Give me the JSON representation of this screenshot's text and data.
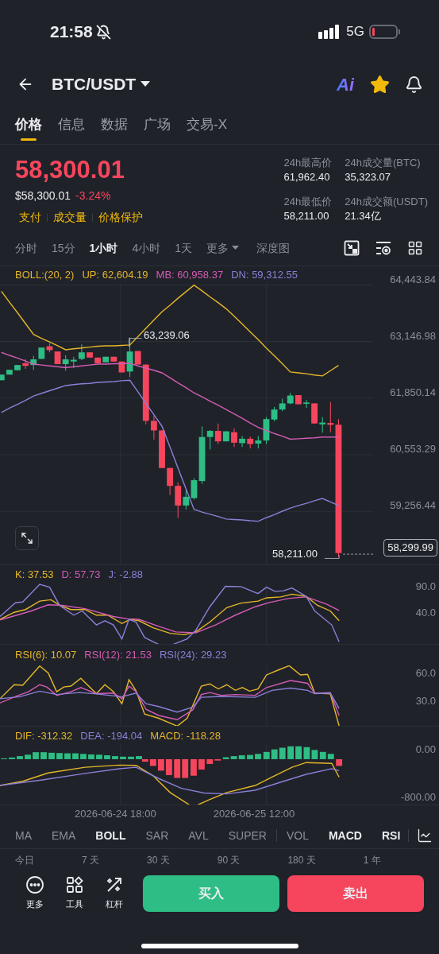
{
  "status_bar": {
    "time": "21:58",
    "network": "5G"
  },
  "header": {
    "pair": "BTC/USDT",
    "ai_label": "Ai",
    "favorite": true
  },
  "tabs": [
    {
      "label": "价格",
      "selected": true
    },
    {
      "label": "信息",
      "selected": false
    },
    {
      "label": "数据",
      "selected": false
    },
    {
      "label": "广场",
      "selected": false
    },
    {
      "label": "交易-X",
      "selected": false
    }
  ],
  "price": {
    "last": "58,300.01",
    "usd_value": "$58,300.01",
    "change": "-3.24%",
    "tags": [
      "支付",
      "成交量",
      "价格保护"
    ]
  },
  "stats": [
    {
      "label": "24h最高价",
      "value": "61,962.40"
    },
    {
      "label": "24h成交量(BTC)",
      "value": "35,323.07"
    },
    {
      "label": "24h最低价",
      "value": "58,211.00"
    },
    {
      "label": "24h成交额(USDT)",
      "value": "21.34亿"
    }
  ],
  "intervals": [
    {
      "label": "分时",
      "selected": false,
      "kind": "option"
    },
    {
      "label": "15分",
      "selected": false,
      "kind": "option"
    },
    {
      "label": "1小时",
      "selected": true,
      "kind": "option"
    },
    {
      "label": "4小时",
      "selected": false,
      "kind": "option"
    },
    {
      "label": "1天",
      "selected": false,
      "kind": "option"
    },
    {
      "label": "更多",
      "selected": false,
      "kind": "dropdown"
    },
    {
      "label": "深度图",
      "selected": false,
      "kind": "option"
    }
  ],
  "main_chart": {
    "legend": [
      {
        "text": "BOLL:(20, 2)",
        "color": "#e5b629"
      },
      {
        "text": "UP: 62,604.19",
        "color": "#e5b629"
      },
      {
        "text": "MB: 60,958.37",
        "color": "#d45bb5"
      },
      {
        "text": "DN: 59,312.55",
        "color": "#8b7fd8"
      }
    ],
    "chart_data": {
      "type": "candlestick",
      "grid": true,
      "categories": [
        null,
        null,
        null,
        null,
        null,
        null,
        null,
        null,
        null,
        null,
        null,
        null,
        null,
        null,
        null,
        null,
        null,
        null,
        null,
        null,
        null,
        null,
        null,
        null,
        null,
        null,
        null,
        null,
        null,
        null,
        null,
        null,
        null,
        null,
        null,
        null,
        null,
        null,
        null,
        null,
        null,
        null,
        null
      ],
      "ylim": [
        58039,
        64489
      ],
      "ohlc": [
        [
          62260,
          62390,
          62260,
          62390
        ],
        [
          62390,
          62500,
          62390,
          62500
        ],
        [
          62490,
          62610,
          62490,
          62610
        ],
        [
          62650,
          62750,
          62520,
          62590
        ],
        [
          62610,
          62820,
          62500,
          62740
        ],
        [
          62750,
          63010,
          62750,
          63010
        ],
        [
          63040,
          63110,
          62900,
          62950
        ],
        [
          62920,
          62920,
          62630,
          62630
        ],
        [
          62630,
          62830,
          62480,
          62740
        ],
        [
          62690,
          62800,
          62540,
          62730
        ],
        [
          62750,
          63080,
          62720,
          62900
        ],
        [
          62900,
          62900,
          62780,
          62780
        ],
        [
          62780,
          62780,
          62650,
          62650
        ],
        [
          62670,
          62800,
          62670,
          62800
        ],
        [
          62800,
          62800,
          62690,
          62690
        ],
        [
          62690,
          62690,
          62440,
          62440
        ],
        [
          62460,
          63240,
          62330,
          62920
        ],
        [
          62930,
          62930,
          62620,
          62620
        ],
        [
          62620,
          62620,
          61250,
          61330
        ],
        [
          61330,
          61450,
          60900,
          61110
        ],
        [
          61110,
          61110,
          60250,
          60250
        ],
        [
          60250,
          60250,
          59630,
          59840
        ],
        [
          59840,
          59920,
          59110,
          59390
        ],
        [
          59390,
          59760,
          59300,
          59590
        ],
        [
          59560,
          60020,
          59530,
          59970
        ],
        [
          59950,
          61200,
          59890,
          60960
        ],
        [
          60960,
          61120,
          60670,
          61100
        ],
        [
          61100,
          61270,
          60800,
          60860
        ],
        [
          60860,
          61090,
          60860,
          61090
        ],
        [
          61070,
          61160,
          60730,
          60830
        ],
        [
          60820,
          60980,
          60730,
          60920
        ],
        [
          60920,
          60970,
          60700,
          60800
        ],
        [
          60810,
          60980,
          60700,
          60880
        ],
        [
          60880,
          61420,
          60800,
          61370
        ],
        [
          61360,
          61650,
          61320,
          61590
        ],
        [
          61590,
          61840,
          61550,
          61730
        ],
        [
          61730,
          61970,
          61710,
          61910
        ],
        [
          61920,
          61920,
          61710,
          61710
        ],
        [
          61720,
          61810,
          61630,
          61750
        ],
        [
          61730,
          61730,
          61270,
          61270
        ],
        [
          61250,
          61420,
          61060,
          61290
        ],
        [
          61280,
          61760,
          61070,
          61240
        ],
        [
          61240,
          61370,
          58210,
          58300
        ]
      ],
      "yticks": [
        {
          "value": 64443.84,
          "label": "64,443.84"
        },
        {
          "value": 63146.98,
          "label": "63,146.98"
        },
        {
          "value": 61850.14,
          "label": "61,850.14"
        },
        {
          "value": 60553.29,
          "label": "60,553.29"
        },
        {
          "value": 59256.44,
          "label": "59,256.44"
        }
      ],
      "series": [
        {
          "type": "line",
          "color": "#e5b629",
          "values": [
            64300,
            64050,
            63810,
            63560,
            63310,
            63220,
            63140,
            63050,
            62960,
            62980,
            63000,
            63020,
            63040,
            63050,
            63050,
            63060,
            63070,
            63260,
            63450,
            63640,
            63830,
            63980,
            64140,
            64290,
            64440,
            64310,
            64170,
            64040,
            63900,
            63730,
            63550,
            63370,
            63190,
            63000,
            62820,
            62640,
            62450,
            62430,
            62410,
            62380,
            62360,
            62480,
            62600
          ]
        },
        {
          "type": "line",
          "color": "#d45bb5",
          "values": [
            62900,
            62830,
            62770,
            62700,
            62630,
            62610,
            62590,
            62570,
            62550,
            62570,
            62590,
            62610,
            62630,
            62630,
            62640,
            62640,
            62650,
            62590,
            62540,
            62490,
            62430,
            62320,
            62200,
            62090,
            61970,
            61880,
            61780,
            61690,
            61590,
            61490,
            61390,
            61280,
            61180,
            61110,
            61040,
            60980,
            60910,
            60920,
            60930,
            60940,
            60960,
            60960,
            60960
          ]
        },
        {
          "type": "line",
          "color": "#8b7fd8",
          "values": [
            61520,
            61620,
            61710,
            61800,
            61900,
            61960,
            62020,
            62080,
            62140,
            62160,
            62180,
            62190,
            62210,
            62220,
            62230,
            62250,
            62260,
            62000,
            61730,
            61470,
            61210,
            60730,
            60250,
            59770,
            59300,
            59240,
            59190,
            59140,
            59080,
            59070,
            59060,
            59040,
            59030,
            59110,
            59180,
            59260,
            59330,
            59390,
            59440,
            59500,
            59550,
            59470,
            59390
          ]
        }
      ]
    },
    "high_label": "63,239.06",
    "low_label": "58,211.00",
    "last_price": "58,299.99"
  },
  "kdj_panel": {
    "legend": [
      {
        "text": "K: 37.53",
        "color": "#e5b629"
      },
      {
        "text": "D: 57.73",
        "color": "#d45bb5"
      },
      {
        "text": "J: -2.88",
        "color": "#8b7fd8"
      }
    ],
    "axis_labels": [
      "90.0",
      "40.0"
    ]
  },
  "rsi_panel": {
    "legend": [
      {
        "text": "RSI(6): 10.07",
        "color": "#e5b629"
      },
      {
        "text": "RSI(12): 21.53",
        "color": "#d45bb5"
      },
      {
        "text": "RSI(24): 29.23",
        "color": "#8b7fd8"
      }
    ],
    "axis_labels": [
      "60.0",
      "30.0"
    ]
  },
  "macd_panel": {
    "legend": [
      {
        "text": "DIF: -312.32",
        "color": "#e5b629"
      },
      {
        "text": "DEA: -194.04",
        "color": "#8b7fd8"
      },
      {
        "text": "MACD: -118.28",
        "color": "#e5b629"
      }
    ],
    "axis_labels": [
      "0.00",
      "-800.00"
    ]
  },
  "time_labels": [
    "2026-06-24 18:00",
    "2026-06-25 12:00"
  ],
  "indicators": {
    "main": [
      {
        "label": "MA",
        "selected": false
      },
      {
        "label": "EMA",
        "selected": false
      },
      {
        "label": "BOLL",
        "selected": true
      },
      {
        "label": "SAR",
        "selected": false
      },
      {
        "label": "AVL",
        "selected": false
      },
      {
        "label": "SUPER",
        "selected": false
      }
    ],
    "sub": [
      {
        "label": "VOL",
        "selected": false
      },
      {
        "label": "MACD",
        "selected": true
      },
      {
        "label": "RSI",
        "selected": true
      }
    ]
  },
  "ranges": [
    "今日",
    "7 天",
    "30 天",
    "90 天",
    "180 天",
    "1 年"
  ],
  "actions": [
    {
      "label": "更多",
      "kind": "more"
    },
    {
      "label": "工具",
      "kind": "tools"
    },
    {
      "label": "杠杆",
      "kind": "leverage"
    }
  ],
  "buy_button": "买入",
  "sell_button": "卖出"
}
